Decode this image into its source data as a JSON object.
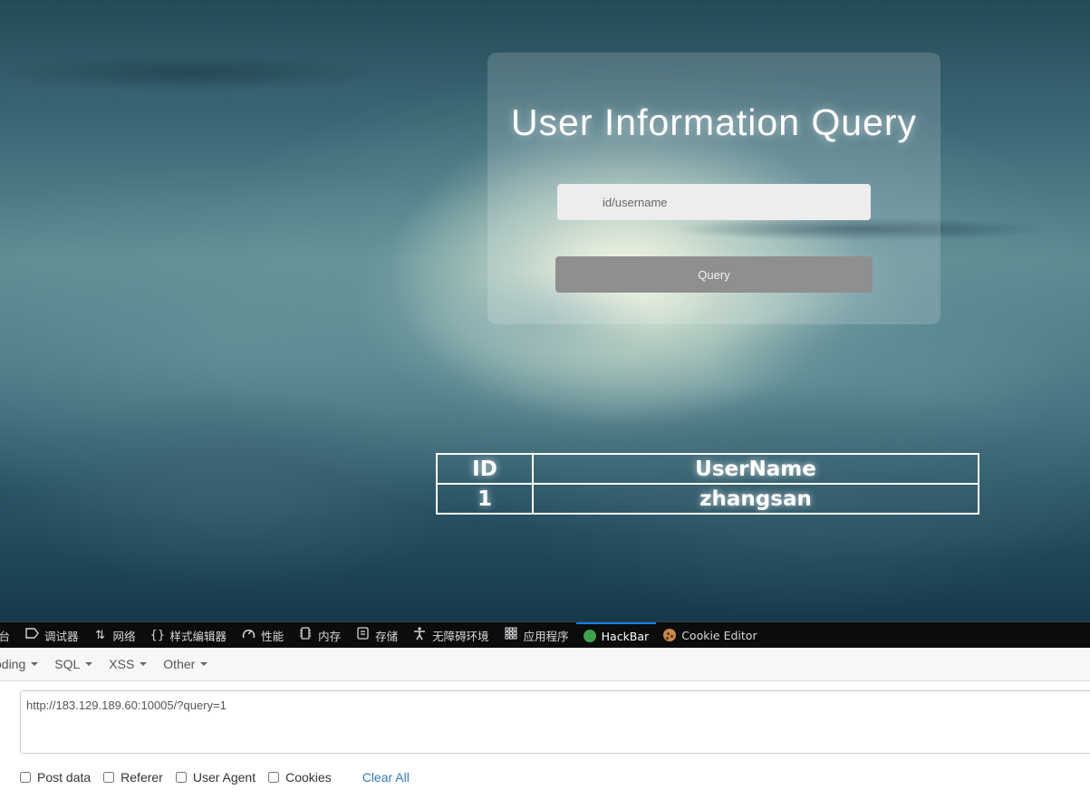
{
  "page": {
    "title": "User Information Query",
    "input_placeholder": "id/username",
    "query_button": "Query"
  },
  "results": {
    "headers": [
      "ID",
      "UserName"
    ],
    "rows": [
      [
        "1",
        "zhangsan"
      ]
    ]
  },
  "devtools": {
    "tabs": [
      {
        "label": "制台",
        "icon": "console-icon"
      },
      {
        "label": "调试器",
        "icon": "debugger-icon"
      },
      {
        "label": "网络",
        "icon": "network-icon"
      },
      {
        "label": "样式编辑器",
        "icon": "style-editor-icon"
      },
      {
        "label": "性能",
        "icon": "performance-icon"
      },
      {
        "label": "内存",
        "icon": "memory-icon"
      },
      {
        "label": "存储",
        "icon": "storage-icon"
      },
      {
        "label": "无障碍环境",
        "icon": "accessibility-icon"
      },
      {
        "label": "应用程序",
        "icon": "application-icon"
      },
      {
        "label": "HackBar",
        "icon": "hackbar-icon",
        "active": true
      },
      {
        "label": "Cookie Editor",
        "icon": "cookie-icon"
      }
    ]
  },
  "hackbar": {
    "menus": [
      "oding",
      "SQL",
      "XSS",
      "Other"
    ],
    "url": "http://183.129.189.60:10005/?query=1",
    "options": [
      "Post data",
      "Referer",
      "User Agent",
      "Cookies"
    ],
    "clear_all": "Clear All"
  },
  "colors": {
    "active_tab_accent": "#0a84ff",
    "link_blue": "#337ab7",
    "button_gray": "#8f8f8f"
  }
}
